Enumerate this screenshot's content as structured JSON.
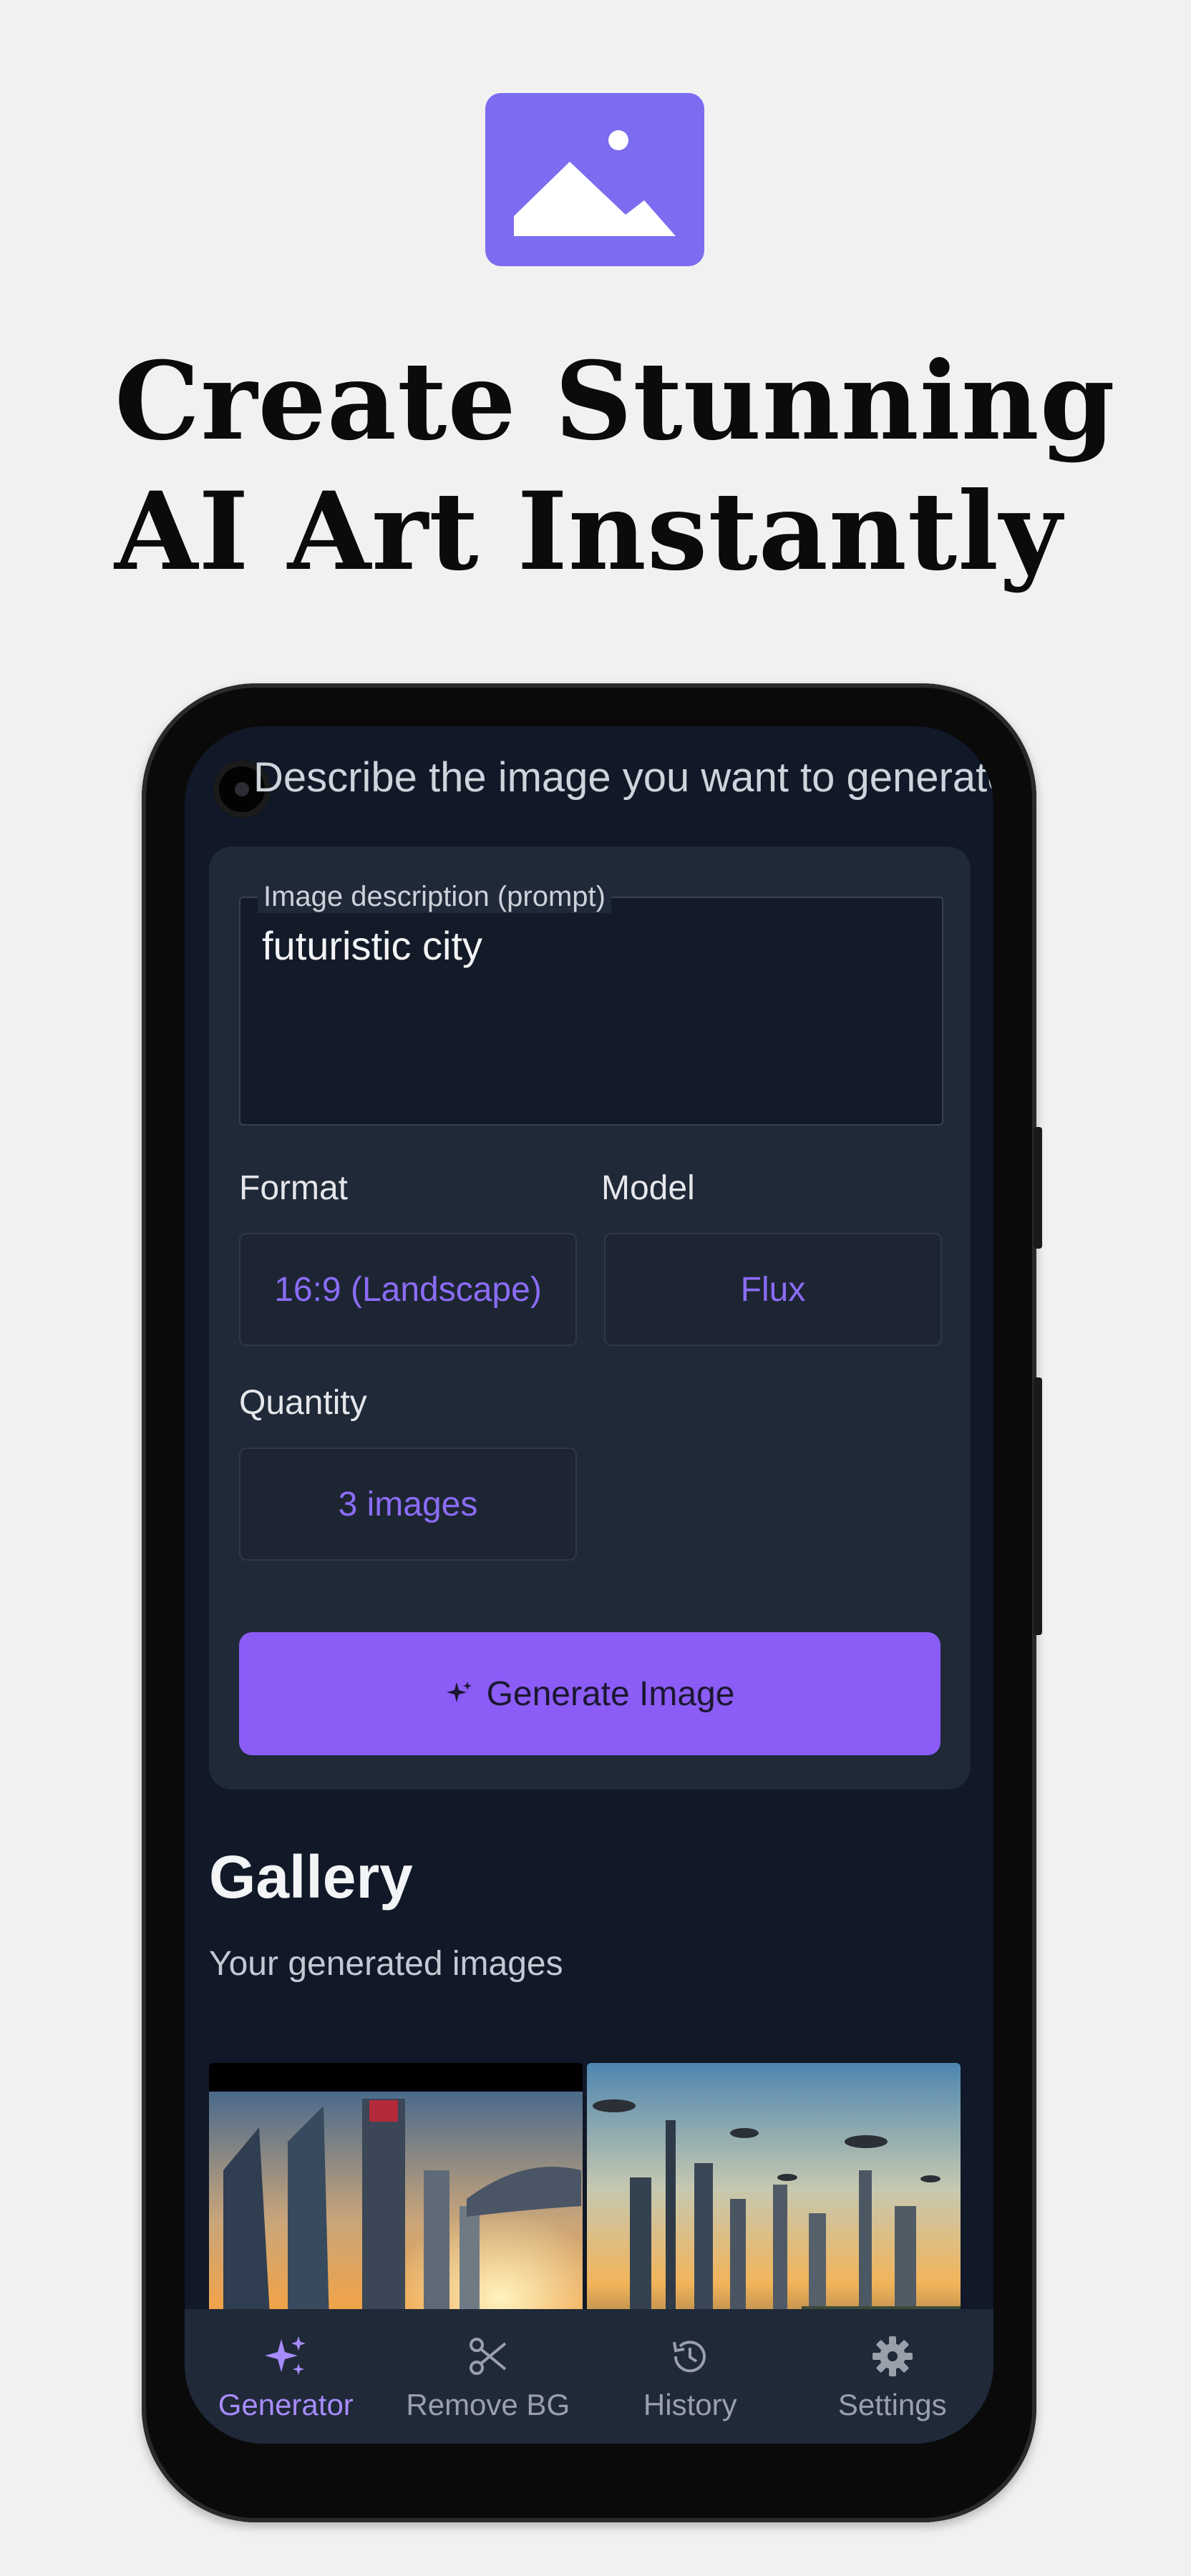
{
  "promo": {
    "headline_line1": "Create Stunning",
    "headline_line2": "AI Art Instantly"
  },
  "app": {
    "instruction": "Describe the image you want to generate",
    "prompt": {
      "label": "Image description (prompt)",
      "value": "futuristic city"
    },
    "format": {
      "label": "Format",
      "value": "16:9 (Landscape)"
    },
    "model": {
      "label": "Model",
      "value": "Flux"
    },
    "quantity": {
      "label": "Quantity",
      "value": "3 images"
    },
    "generate_label": "Generate Image",
    "gallery": {
      "title": "Gallery",
      "subtitle": "Your generated images"
    },
    "nav": [
      {
        "label": "Generator",
        "icon": "sparkles-icon",
        "active": true
      },
      {
        "label": "Remove BG",
        "icon": "scissors-icon",
        "active": false
      },
      {
        "label": "History",
        "icon": "history-icon",
        "active": false
      },
      {
        "label": "Settings",
        "icon": "gear-icon",
        "active": false
      }
    ]
  },
  "colors": {
    "accent": "#8b5cf6",
    "logo": "#7c6cf0",
    "screen_bg": "#111827",
    "card_bg": "#1f2937"
  }
}
